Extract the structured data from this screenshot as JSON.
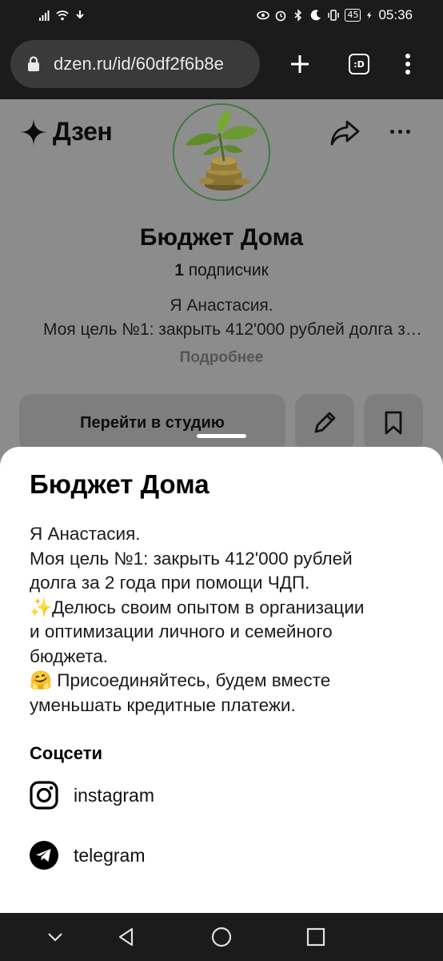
{
  "status_bar": {
    "battery": "45",
    "time": "05:36"
  },
  "browser": {
    "url": "dzen.ru/id/60df2f6b8e",
    "tabs_label": ":D",
    "icons": [
      "lock-icon",
      "plus-icon",
      "tabs-icon",
      "kebab-menu-icon"
    ]
  },
  "page": {
    "logo": "Дзен",
    "channel_title": "Бюджет Дома",
    "subscribers_count": "1",
    "subscribers_label": "подписчик",
    "desc_line1": "Я Анастасия.",
    "desc_line2": "Моя цель №1: закрыть 412'000 рублей долга за 2 года при помощи ЧДП.",
    "more_link": "Подробнее",
    "studio_button": "Перейти в студию"
  },
  "sheet": {
    "title": "Бюджет Дома",
    "description_lines": [
      "Я Анастасия.",
      "Моя цель №1: закрыть 412'000 рублей",
      "долга за 2 года при помощи ЧДП.",
      "✨Делюсь своим опытом в организации",
      "и оптимизации личного и семейного",
      "бюджета.",
      "🤗 Присоединяйтесь, будем вместе",
      "уменьшать кредитные платежи."
    ],
    "socials_heading": "Соцсети",
    "socials": [
      {
        "label": "instagram",
        "icon": "instagram-icon"
      },
      {
        "label": "telegram",
        "icon": "telegram-icon"
      }
    ]
  },
  "colors": {
    "overlay_gray": "#8c8c8c",
    "system_bar": "#1b1b1b",
    "sheet_bg": "#ffffff"
  }
}
